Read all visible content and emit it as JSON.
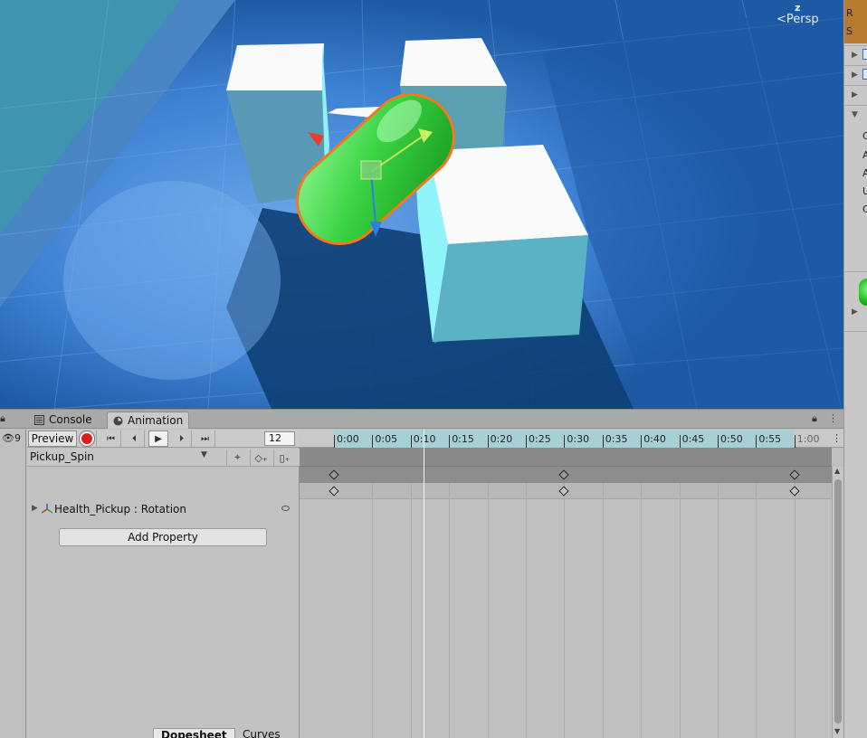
{
  "scene": {
    "gizmo_axis": "z",
    "projection_label": "Persp"
  },
  "tabs": [
    {
      "label": "Console",
      "icon": "console-icon",
      "active": false
    },
    {
      "label": "Animation",
      "icon": "clock-icon",
      "active": true
    }
  ],
  "gutter": {
    "visibility_count": "9"
  },
  "controls": {
    "preview_label": "Preview",
    "current_frame": "12"
  },
  "clip": {
    "name": "Pickup_Spin"
  },
  "property": {
    "label": "Health_Pickup : Rotation"
  },
  "add_property_label": "Add Property",
  "bottom_tabs": {
    "dopesheet": "Dopesheet",
    "curves": "Curves"
  },
  "ruler": {
    "labels": [
      "0:00",
      "0:05",
      "0:10",
      "0:15",
      "0:20",
      "0:25",
      "0:30",
      "0:35",
      "0:40",
      "0:45",
      "0:50",
      "0:55",
      "1:00"
    ],
    "playhead_frame": 12,
    "keyframes": [
      "0:00",
      "0:30",
      "1:00"
    ]
  },
  "inspector": {
    "visible_letters": [
      "R",
      "S",
      "C",
      "A",
      "A",
      "U",
      "C"
    ]
  },
  "colors": {
    "accent_selection": "#f07a1e",
    "pickup_green": "#33d03a",
    "record_red": "#d82020",
    "ruler_active": "#a7cfd6"
  }
}
